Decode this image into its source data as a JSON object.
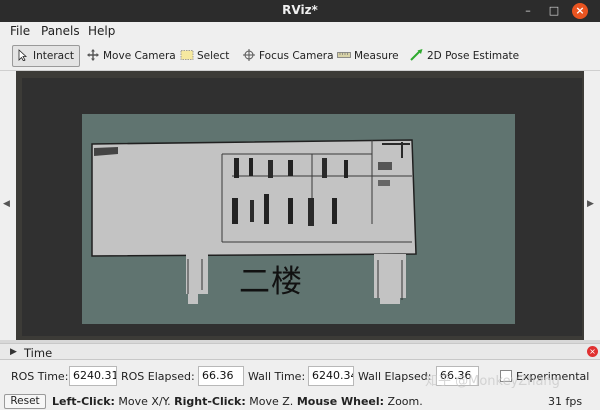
{
  "window": {
    "title": "RViz*"
  },
  "menu": {
    "items": [
      "File",
      "Panels",
      "Help"
    ]
  },
  "toolbar": {
    "tools": [
      {
        "label": "Interact",
        "icon": "cursor-icon"
      },
      {
        "label": "Move Camera",
        "icon": "move-arrows-icon"
      },
      {
        "label": "Select",
        "icon": "select-rect-icon"
      },
      {
        "label": "Focus Camera",
        "icon": "crosshair-icon"
      },
      {
        "label": "Measure",
        "icon": "ruler-icon"
      },
      {
        "label": "2D Pose Estimate",
        "icon": "green-arrow-icon"
      }
    ],
    "active": "Interact"
  },
  "viewport": {
    "overlay_text": "二楼",
    "map_background": "#607470",
    "map_free_space": "#c3c3c3"
  },
  "time_panel": {
    "title": "Time",
    "ros_time_label": "ROS Time:",
    "ros_time_value": "6240.31",
    "ros_elapsed_label": "ROS Elapsed:",
    "ros_elapsed_value": "66.36",
    "wall_time_label": "Wall Time:",
    "wall_time_value": "6240.34",
    "wall_elapsed_label": "Wall Elapsed:",
    "wall_elapsed_value": "66.36",
    "experimental_label": "Experimental"
  },
  "statusbar": {
    "reset_label": "Reset",
    "hint_left_key": "Left-Click:",
    "hint_left_val": " Move X/Y. ",
    "hint_right_key": "Right-Click:",
    "hint_right_val": " Move Z. ",
    "hint_wheel_key": "Mouse Wheel:",
    "hint_wheel_val": " Zoom.",
    "fps": "31 fps"
  },
  "watermark": "知乎 @MonkeyZhang"
}
